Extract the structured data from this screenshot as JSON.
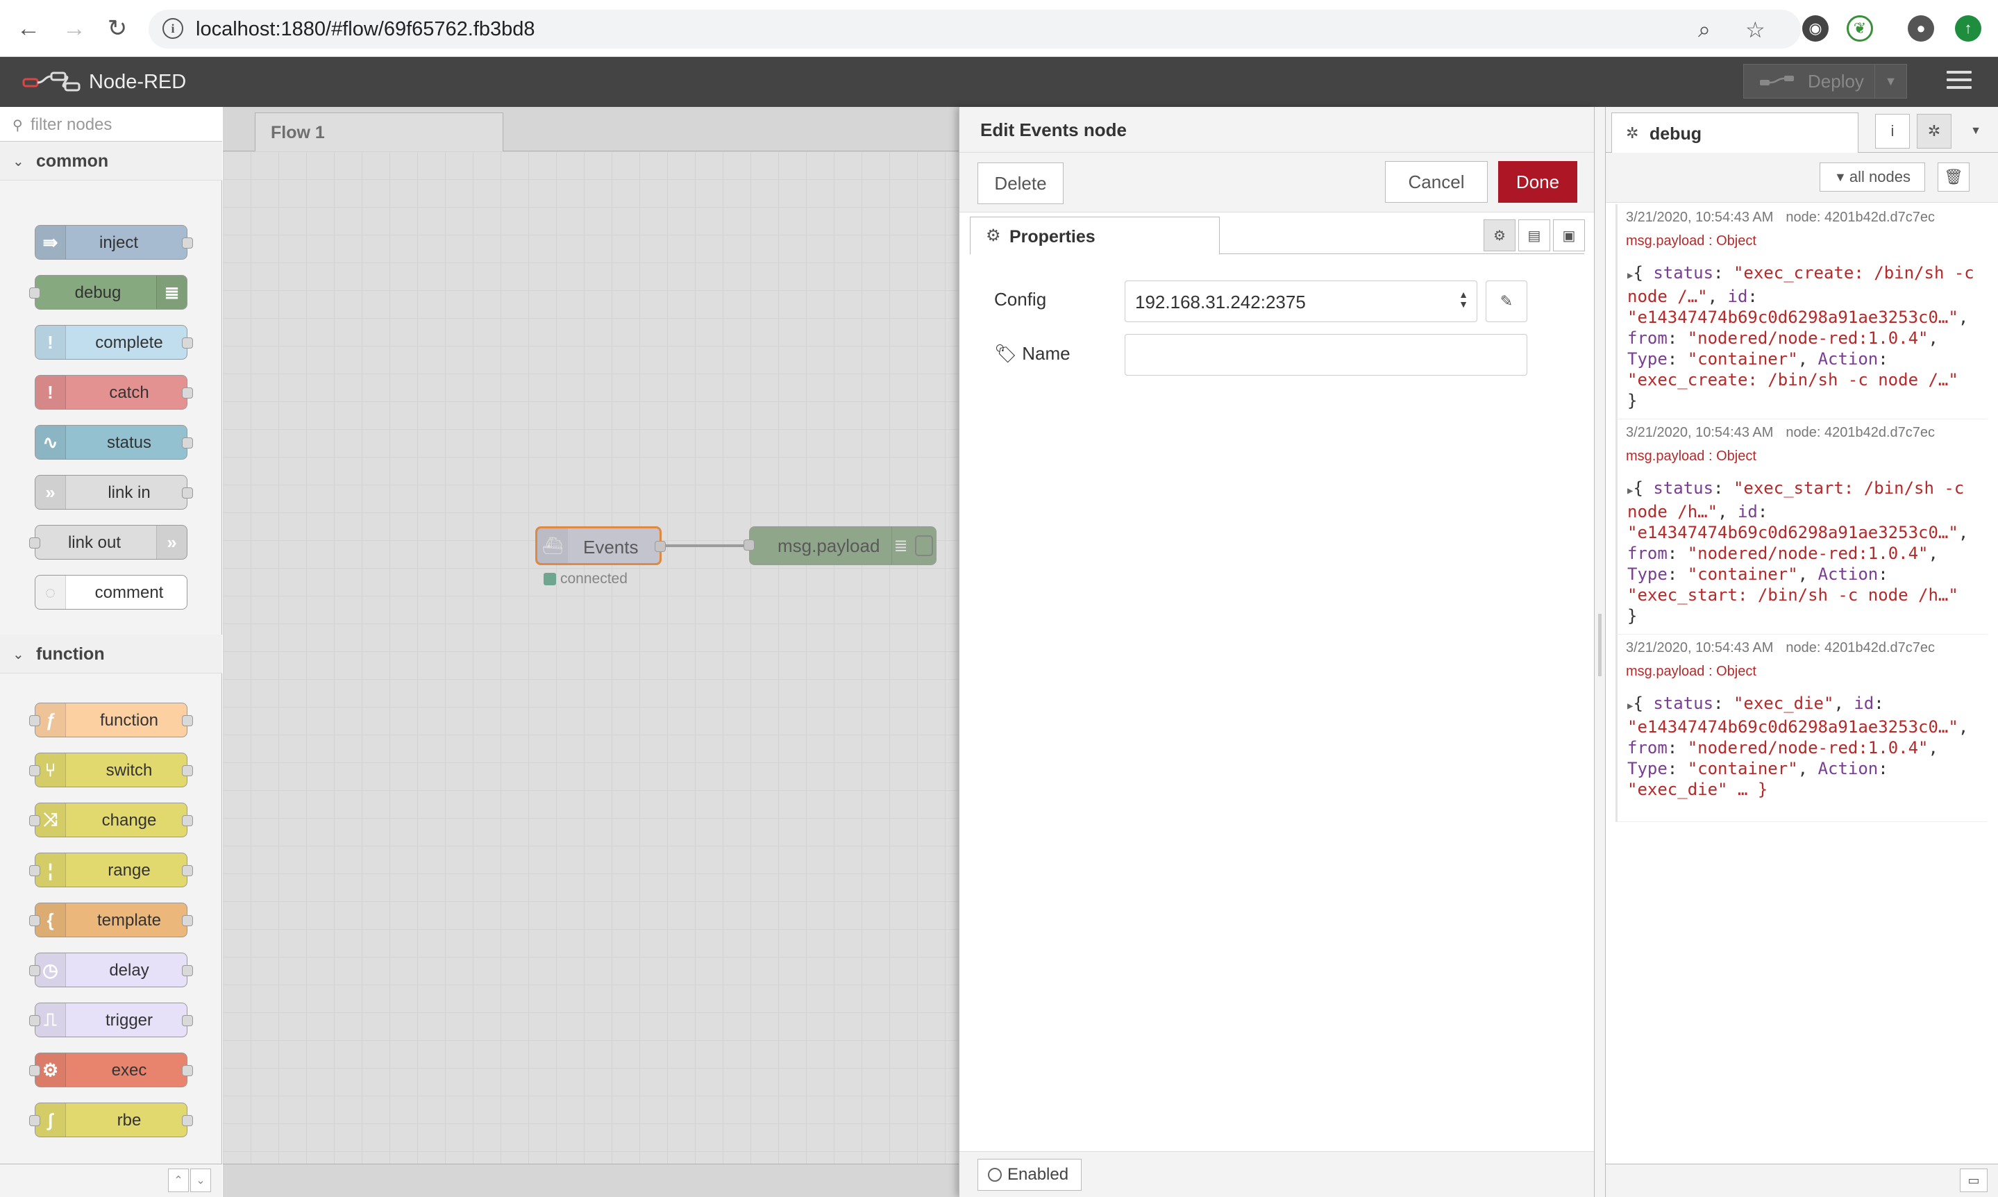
{
  "browser": {
    "url": "localhost:1880/#flow/69f65762.fb3bd8"
  },
  "header": {
    "title": "Node-RED",
    "deploy_label": "Deploy"
  },
  "palette": {
    "filter_placeholder": "filter nodes",
    "categories": [
      {
        "label": "common",
        "nodes": [
          "inject",
          "debug",
          "complete",
          "catch",
          "status",
          "link in",
          "link out",
          "comment"
        ]
      },
      {
        "label": "function",
        "nodes": [
          "function",
          "switch",
          "change",
          "range",
          "template",
          "delay",
          "trigger",
          "exec",
          "rbe"
        ]
      }
    ]
  },
  "workspace": {
    "tab_label": "Flow 1",
    "nodes": {
      "events_label": "Events",
      "events_status": "connected",
      "debug_label": "msg.payload"
    }
  },
  "tray": {
    "title": "Edit Events node",
    "delete_label": "Delete",
    "cancel_label": "Cancel",
    "done_label": "Done",
    "tab_label": "Properties",
    "config_label": "Config",
    "config_value": "192.168.31.242:2375",
    "name_label": "Name",
    "name_value": "",
    "enabled_label": "Enabled"
  },
  "sidebar": {
    "tab_label": "debug",
    "filter_label": "all nodes",
    "messages": [
      {
        "timestamp": "3/21/2020, 10:54:43 AM",
        "node": "node: 4201b42d.d7c7ec",
        "type": "msg.payload : Object",
        "lines": [
          [
            "{ ",
            "status",
            ": ",
            "\"exec_create: /bin/sh -c"
          ],
          [
            "",
            "",
            "",
            "node /…\""
          ],
          [
            "",
            "id",
            ":",
            ""
          ],
          [
            "",
            "",
            "",
            "\"e14347474b69c0d6298a91ae3253c0…\""
          ],
          [
            "",
            "from",
            ": ",
            "\"nodered/node-red:1.0.4\""
          ],
          [
            "",
            "Type",
            ": ",
            "\"container\""
          ],
          [
            "",
            "Action",
            ":",
            ""
          ],
          [
            "",
            "",
            "",
            "\"exec_create: /bin/sh -c node /…\""
          ],
          [
            "}",
            "",
            "",
            ""
          ]
        ]
      },
      {
        "timestamp": "3/21/2020, 10:54:43 AM",
        "node": "node: 4201b42d.d7c7ec",
        "type": "msg.payload : Object",
        "lines": [
          [
            "{ ",
            "status",
            ": ",
            "\"exec_start: /bin/sh -c"
          ],
          [
            "",
            "",
            "",
            "node /h…\""
          ],
          [
            "",
            "id",
            ":",
            ""
          ],
          [
            "",
            "",
            "",
            "\"e14347474b69c0d6298a91ae3253c0…\""
          ],
          [
            "",
            "from",
            ": ",
            "\"nodered/node-red:1.0.4\""
          ],
          [
            "",
            "Type",
            ": ",
            "\"container\""
          ],
          [
            "",
            "Action",
            ":",
            ""
          ],
          [
            "",
            "",
            "",
            "\"exec_start: /bin/sh -c node /h…\""
          ],
          [
            "}",
            "",
            "",
            ""
          ]
        ]
      },
      {
        "timestamp": "3/21/2020, 10:54:43 AM",
        "node": "node: 4201b42d.d7c7ec",
        "type": "msg.payload : Object",
        "lines": [
          [
            "{ ",
            "status",
            ": ",
            "\"exec_die\""
          ],
          [
            "",
            "id",
            ":",
            ""
          ],
          [
            "",
            "",
            "",
            "\"e14347474b69c0d6298a91ae3253c0…\""
          ],
          [
            "",
            "from",
            ": ",
            "\"nodered/node-red:1.0.4\""
          ],
          [
            "",
            "Type",
            ": ",
            "\"container\""
          ],
          [
            "",
            "Action",
            ":",
            ""
          ],
          [
            "",
            "",
            "",
            "\"exec_die\" … }"
          ]
        ]
      }
    ]
  },
  "colors": {
    "header_bg": "#444444",
    "done_button": "#ad1625",
    "inject": "#a6bbcf",
    "debug": "#87a980",
    "complete": "#c0deed",
    "catch": "#e49191",
    "status": "#94c1d0",
    "link": "#dddddd",
    "comment": "#ffffff",
    "function": "#fdd0a2",
    "switch": "#e2d96e",
    "change": "#e2d96e",
    "range": "#e2d96e",
    "template": "#ebb77b",
    "delay": "#e6e0f8",
    "trigger": "#e6e0f8",
    "exec": "#e8846e",
    "rbe": "#e2d96e",
    "events": "#d7d7e8"
  }
}
